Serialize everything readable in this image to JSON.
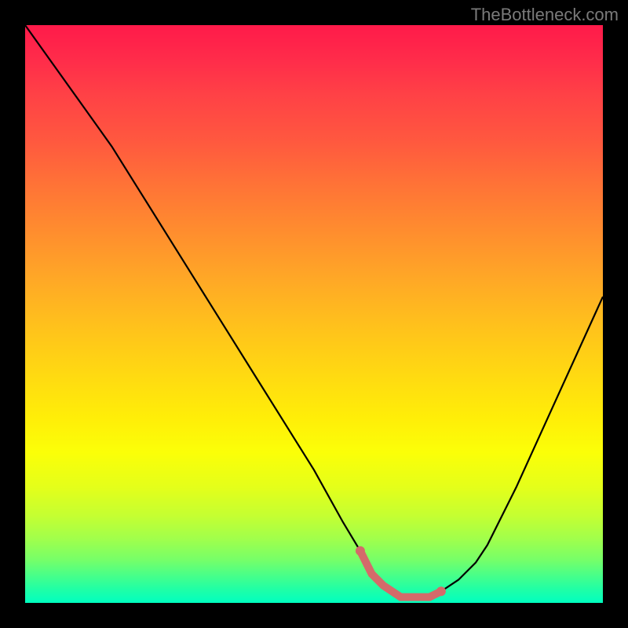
{
  "watermark": "TheBottleneck.com",
  "chart_data": {
    "type": "line",
    "title": "",
    "xlabel": "",
    "ylabel": "",
    "xlim": [
      0,
      100
    ],
    "ylim": [
      0,
      100
    ],
    "series": [
      {
        "name": "curve",
        "x": [
          0,
          5,
          10,
          15,
          20,
          25,
          30,
          35,
          40,
          45,
          50,
          55,
          58,
          60,
          62,
          65,
          68,
          70,
          72,
          75,
          78,
          80,
          85,
          90,
          95,
          100
        ],
        "y": [
          100,
          93,
          86,
          79,
          71,
          63,
          55,
          47,
          39,
          31,
          23,
          14,
          9,
          5,
          3,
          1,
          1,
          1,
          2,
          4,
          7,
          10,
          20,
          31,
          42,
          53
        ]
      },
      {
        "name": "highlight-band",
        "x": [
          58,
          60,
          62,
          65,
          68,
          70,
          72
        ],
        "y": [
          9,
          5,
          3,
          1,
          1,
          1,
          2
        ]
      }
    ],
    "highlight_color": "#d46a6a",
    "curve_color": "#000000",
    "gradient_stops": [
      {
        "pos": 0.0,
        "color": "#ff1a4a"
      },
      {
        "pos": 0.2,
        "color": "#ff583f"
      },
      {
        "pos": 0.4,
        "color": "#ff9e2a"
      },
      {
        "pos": 0.6,
        "color": "#ffd812"
      },
      {
        "pos": 0.8,
        "color": "#e4ff1a"
      },
      {
        "pos": 0.92,
        "color": "#77ff68"
      },
      {
        "pos": 1.0,
        "color": "#00ffc0"
      }
    ],
    "background_outside": "#000000"
  }
}
